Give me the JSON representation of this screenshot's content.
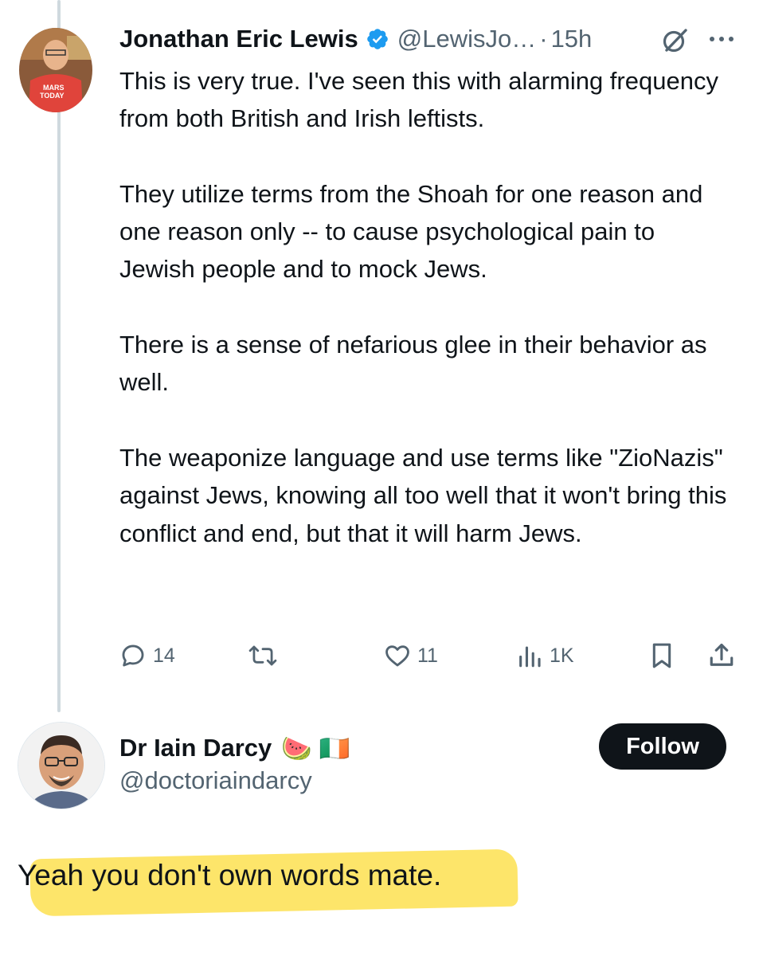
{
  "tweet1": {
    "author_name": "Jonathan Eric Lewis",
    "handle": "@LewisJo…",
    "separator": "·",
    "time": "15h",
    "avatar_shirt_text": "MARS TODAY",
    "paragraphs": [
      "This is very true.  I've seen this with alarming frequency from both British and Irish leftists.",
      "They utilize terms from the Shoah for one reason and one reason only -- to cause psychological pain to Jewish people and to mock Jews.",
      "There is a sense of nefarious glee in their behavior as well.",
      "The weaponize language and use terms like \"ZioNazis\" against Jews, knowing all too well that it won't bring this conflict and end, but that it will harm Jews."
    ],
    "actions": {
      "replies": "14",
      "retweets": "",
      "likes": "11",
      "views": "1K"
    }
  },
  "tweet2": {
    "author_name": "Dr Iain Darcy",
    "emojis": "🍉 🇮🇪",
    "handle": "@doctoriaindarcy",
    "follow_label": "Follow",
    "reply_text": "Yeah you don't own words mate."
  },
  "icons": {
    "verified": "verified-badge-icon",
    "grok": "grok-icon",
    "more": "more-icon",
    "reply": "reply-icon",
    "retweet": "retweet-icon",
    "like": "like-icon",
    "views": "views-icon",
    "bookmark": "bookmark-icon",
    "share": "share-icon"
  },
  "colors": {
    "text": "#0f1419",
    "secondary": "#536471",
    "verified_blue": "#1d9bf0",
    "thread_line": "#cfd9de",
    "follow_bg": "#0f1419",
    "highlight": "#fde25a"
  }
}
